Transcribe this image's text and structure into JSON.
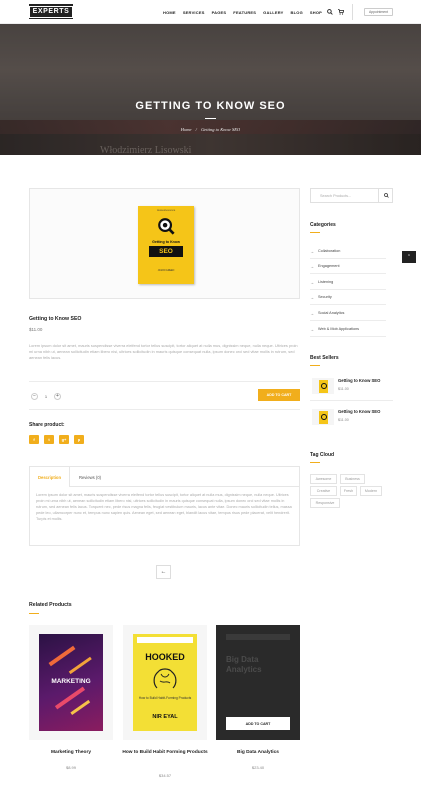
{
  "header": {
    "logo": "EXPERTS",
    "nav": [
      "HOME",
      "SERVICES",
      "PAGES",
      "FEATURES",
      "GALLERY",
      "BLOG",
      "SHOP"
    ],
    "appointment_label": "Appointment"
  },
  "hero": {
    "title": "GETTING TO KNOW SEO",
    "breadcrumb_home": "Home",
    "breadcrumb_sep": "/",
    "breadcrumb_current": "Getting to Know SEO",
    "spine_text": "Włodzimierz Lisowski"
  },
  "product": {
    "cover": {
      "publisher": "PENGUIN BOOKS",
      "line1": "Getting to Know",
      "line2": "SEO",
      "author": "JASON GREEN"
    },
    "title": "Getting to Know SEO",
    "price": "$11.00",
    "description": "Lorem ipsum dolor sit amet, mauris suspendisse viverra eleifend tortor tellus suscipit, tortor aliquet at nulla mus, dignissim neque, nulla neque. Ultrices proin mi urna nibh ut, aenean sollicitudin etiam libero nisi, ultrices sollicitudin in mauris quisque consequat nulla, ipsum donec orci sed vitae mollis in rutrum, sed aenean felis lacus.",
    "quantity": "1",
    "add_to_cart": "ADD TO CART",
    "share_label": "Share product:",
    "share_icons": [
      "f",
      "t",
      "g+",
      "p"
    ]
  },
  "tabs": {
    "items": [
      "Description",
      "Reviews (0)"
    ],
    "body": "Lorem ipsum dolor sit amet, mauris suspendisse viverra eleifend tortor tellus suscipit, tortor aliquet at nulla mus, dignissim neque, nulla neque. Ultrices proin mi urna nibh ut, aenean sollicitudin etiam libero nisi, ultrices sollicitudin in mauris quisque consequat nulla, ipsum donec orci sed vitae mollis in rutrum, sed aenean felis lacus. Torquent nec, pede risus magna felis, feugiat vestibulum mauris, lacus ante vitae. Donec mauris sollicitudin tellus, massa pede leo, ullamcorper nunc et, tempus nunc sapien quis. Aenean eget, sed aenean eget, blandit lacus vitae, tempus risus pede placerat, velit hendrerit. Turpis et mollis."
  },
  "related": {
    "title": "Related Products",
    "products": [
      {
        "title": "Marketing Theory",
        "price": "$8.99",
        "cover_title": "MARKETING"
      },
      {
        "title": "How to Build Habit Forming Products",
        "price": "$34.57",
        "cover_title": "HOOKED",
        "cover_sub": "How to Build Habit-Forming Products",
        "cover_author": "NIR EYAL"
      },
      {
        "title": "Big Data Analytics",
        "price": "$23.40",
        "cover_title": "Big Data Analytics",
        "add_to_cart": "ADD TO CART"
      }
    ]
  },
  "sidebar": {
    "search_placeholder": "Search Products...",
    "categories_title": "Categories",
    "categories": [
      "Collaboration",
      "Engagement",
      "Listening",
      "Security",
      "Social Analytics",
      "Web & Mob Applications"
    ],
    "bestsellers_title": "Best Sellers",
    "bestsellers": [
      {
        "title": "Getting to Know SEO",
        "price": "$11.00"
      },
      {
        "title": "Getting to Know SEO",
        "price": "$11.00"
      }
    ],
    "tags_title": "Tag Cloud",
    "tags": [
      "Awesome",
      "Business",
      "Creative",
      "Fresh",
      "Modern",
      "Responsive"
    ]
  },
  "colors": {
    "accent": "#f1ae1c",
    "dark": "#222222"
  }
}
